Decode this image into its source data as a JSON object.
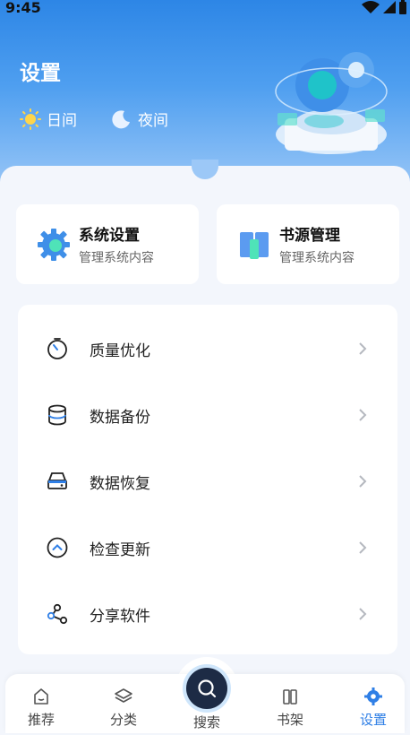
{
  "status": {
    "time": "9:45"
  },
  "header": {
    "title": "设置",
    "modes": [
      {
        "label": "日间",
        "icon": "sun-icon"
      },
      {
        "label": "夜间",
        "icon": "moon-icon"
      }
    ]
  },
  "quick_cards": [
    {
      "title": "系统设置",
      "subtitle": "管理系统内容",
      "icon": "gear-icon"
    },
    {
      "title": "书源管理",
      "subtitle": "管理系统内容",
      "icon": "book-icon"
    }
  ],
  "menu": [
    {
      "label": "质量优化",
      "icon": "timer-icon"
    },
    {
      "label": "数据备份",
      "icon": "database-icon"
    },
    {
      "label": "数据恢复",
      "icon": "drive-icon"
    },
    {
      "label": "检查更新",
      "icon": "chevron-up-circle-icon"
    },
    {
      "label": "分享软件",
      "icon": "share-icon"
    }
  ],
  "nav": {
    "items": [
      {
        "label": "推荐",
        "icon": "home-icon"
      },
      {
        "label": "分类",
        "icon": "layers-icon"
      },
      {
        "label": "搜索",
        "icon": "search-icon"
      },
      {
        "label": "书架",
        "icon": "bookshelf-icon"
      },
      {
        "label": "设置",
        "icon": "settings-icon"
      }
    ],
    "active": "设置"
  },
  "colors": {
    "primary": "#2f7fe6",
    "header_top": "#2d86e6",
    "background": "#f3f6fc",
    "search_button": "#1d2b45"
  }
}
